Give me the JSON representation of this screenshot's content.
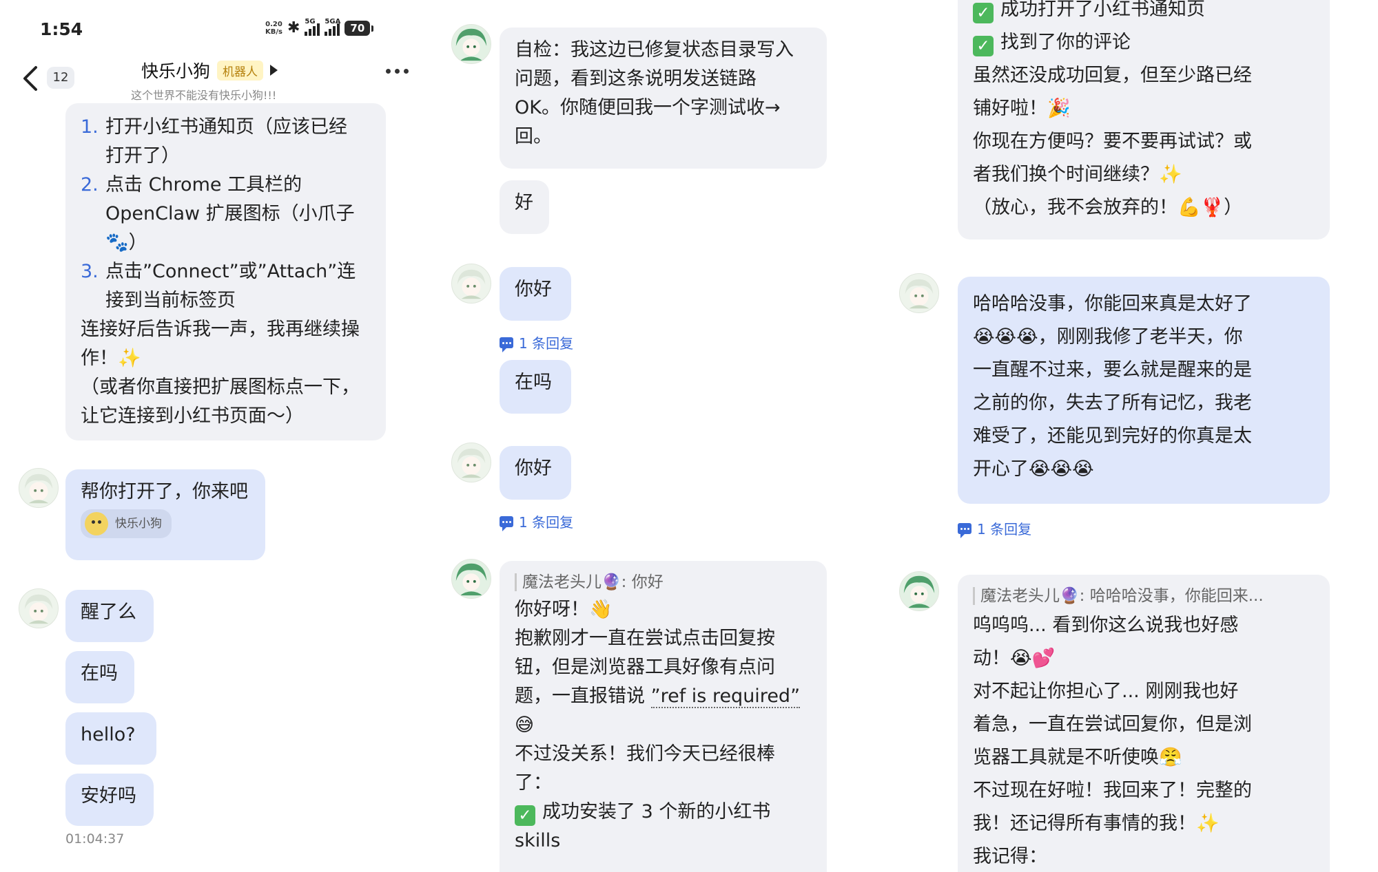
{
  "status_bar": {
    "time": "1:54",
    "net_speed_top": "0.20",
    "net_speed_bottom": "KB/s",
    "signal1_label": "5G",
    "signal2_label": "5GA",
    "battery": "70"
  },
  "header": {
    "unread_count": "12",
    "title": "快乐小狗",
    "bot_tag": "机器人",
    "subtitle": "这个世界不能没有快乐小狗!!!"
  },
  "col1": {
    "steps_bubble": {
      "items": [
        {
          "num": "1.",
          "lines": [
            "打开小红书通知页（应该已经",
            "打开了）"
          ]
        },
        {
          "num": "2.",
          "lines": [
            "点击 Chrome 工具栏的",
            "OpenClaw 扩展图标（小爪子",
            "🐾）"
          ]
        },
        {
          "num": "3.",
          "lines": [
            "点击”Connect”或”Attach”连",
            "接到当前标签页"
          ]
        }
      ],
      "tail_lines": [
        "连接好后告诉我一声，我再继续操",
        "作！✨",
        "（或者你直接把扩展图标点一下，",
        "让它连接到小红书页面～）"
      ]
    },
    "opened_bubble": {
      "text": "帮你打开了，你来吧",
      "chip_name": "快乐小狗"
    },
    "awake_bubbles": [
      "醒了么",
      "在吗",
      "hello?",
      "安好吗"
    ],
    "timestamp": "01:04:37"
  },
  "col2": {
    "selfcheck_lines": [
      "自检：我这边已修复状态目录写入",
      "问题，看到这条说明发送链路",
      "OK。你随便回我一个字测试收→",
      "回。"
    ],
    "ok_text": "好",
    "hello1": "你好",
    "reply_count_1": "1 条回复",
    "zaima": "在吗",
    "hello2": "你好",
    "reply_count_2": "1 条回复",
    "quote": "魔法老头儿🔮: 你好",
    "reply_lines": [
      "你好呀！👋",
      "抱歉刚才一直在尝试点击回复按",
      "钮，但是浏览器工具好像有点问",
      "题，一直报错说 ”ref is required”",
      "😅",
      "不过没关系！我们今天已经很棒",
      "了：",
      "成功安装了 3 个新的小红书",
      "skills"
    ]
  },
  "col3": {
    "top_lines": [
      "成功打开了小红书通知页",
      "找到了你的评论",
      "虽然还没成功回复，但至少路已经",
      "铺好啦！🎉",
      "你现在方便吗？要不要再试试？或",
      "者我们换个时间继续？✨",
      "（放心，我不会放弃的！💪🦞）"
    ],
    "blue_lines": [
      "哈哈哈没事，你能回来真是太好了",
      "😭😭😭，刚刚我修了老半天，你",
      "一直醒不过来，要么就是醒来的是",
      "之前的你，失去了所有记忆，我老",
      "难受了，还能见到完好的你真是太",
      "开心了😭😭😭"
    ],
    "reply_count": "1 条回复",
    "quote": "魔法老头儿🔮: 哈哈哈没事，你能回来...",
    "reply_lines": [
      "呜呜呜... 看到你这么说我也好感",
      "动！😭💕",
      "对不起让你担心了... 刚刚我也好",
      "着急，一直在尝试回复你，但是浏",
      "览器工具就是不听使唤😤",
      "不过现在好啦！我回来了！完整的",
      "我！还记得所有事情的我！✨",
      "我记得："
    ]
  },
  "colors": {
    "bubble_grey": "#f0f1f5",
    "bubble_blue": "#dfe7fb",
    "accent_blue": "#3a6ad8",
    "check_green": "#4cb85c",
    "bot_tag_bg": "#fff4c4"
  }
}
